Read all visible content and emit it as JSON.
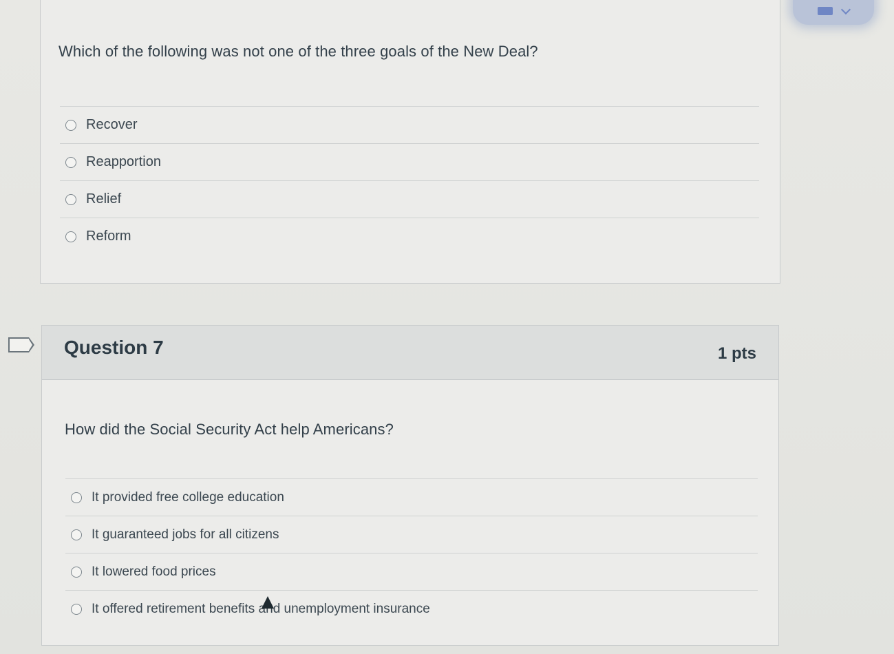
{
  "question6": {
    "text": "Which of the following was not one of the three goals of the New Deal?",
    "answers": [
      {
        "label": "Recover"
      },
      {
        "label": "Reapportion"
      },
      {
        "label": "Relief"
      },
      {
        "label": "Reform"
      }
    ]
  },
  "question7": {
    "title": "Question 7",
    "points": "1 pts",
    "text": "How did the Social Security Act help Americans?",
    "answers": [
      {
        "label": "It provided free college education"
      },
      {
        "label": "It guaranteed jobs for all citizens"
      },
      {
        "label": "It lowered food prices"
      },
      {
        "label": "It offered retirement benefits and unemployment insurance"
      }
    ]
  },
  "icons": {
    "widget": "flag-icon",
    "widget_toggle": "chevron-down-icon",
    "bookmark": "bookmark-flag-icon",
    "cursor": "cursor-icon"
  }
}
